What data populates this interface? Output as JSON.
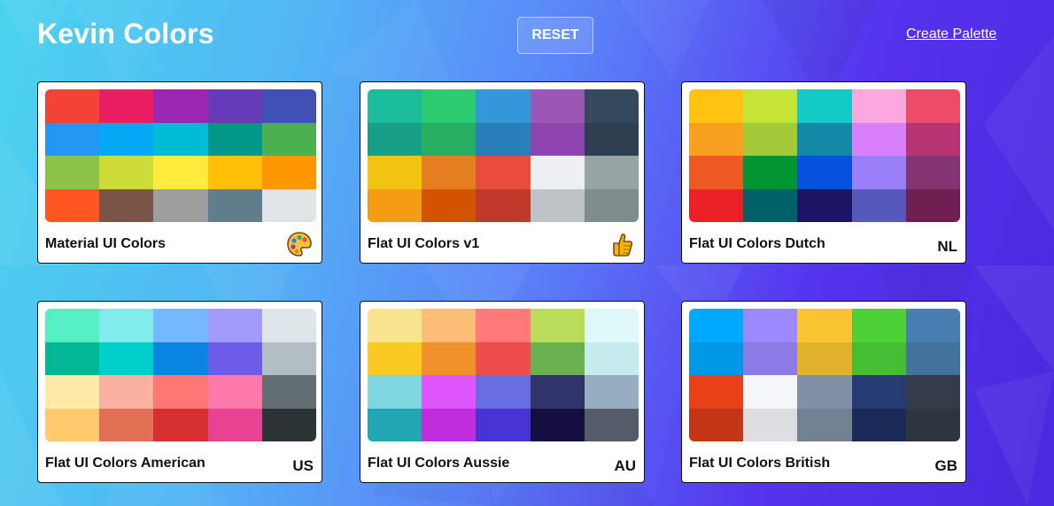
{
  "header": {
    "brand": "Kevin Colors",
    "reset_label": "RESET",
    "create_label": "Create Palette"
  },
  "palettes": [
    {
      "name": "Material UI Colors",
      "badge_type": "emoji",
      "badge_icon": "palette-icon",
      "colors": [
        [
          "#f44336",
          "#e91e63",
          "#9c27b0",
          "#673ab7",
          "#3f51b5"
        ],
        [
          "#2196f3",
          "#03a9f4",
          "#00bcd4",
          "#009688",
          "#4caf50"
        ],
        [
          "#8bc34a",
          "#cddc39",
          "#ffeb3b",
          "#ffc107",
          "#ff9800"
        ],
        [
          "#ff5722",
          "#795548",
          "#9e9e9e",
          "#607d8b",
          "#dfe4e7"
        ]
      ]
    },
    {
      "name": "Flat UI Colors v1",
      "badge_type": "emoji",
      "badge_icon": "thumbs-up-icon",
      "colors": [
        [
          "#1abc9c",
          "#2ecc71",
          "#3498db",
          "#9b59b6",
          "#34495e"
        ],
        [
          "#16a085",
          "#27ae60",
          "#2980b9",
          "#8e44ad",
          "#2c3e50"
        ],
        [
          "#f1c40f",
          "#e67e22",
          "#e74c3c",
          "#ecf0f1",
          "#95a5a6"
        ],
        [
          "#f39c12",
          "#d35400",
          "#c0392b",
          "#bdc3c7",
          "#7f8c8d"
        ]
      ]
    },
    {
      "name": "Flat UI Colors Dutch",
      "badge_type": "code",
      "badge": "NL",
      "colors": [
        [
          "#ffc312",
          "#c4e538",
          "#12cbc4",
          "#fda7df",
          "#ed4c67"
        ],
        [
          "#f79f1f",
          "#a3cb38",
          "#1289a7",
          "#d980fa",
          "#b53471"
        ],
        [
          "#ee5a24",
          "#009432",
          "#0652dd",
          "#9980fa",
          "#833471"
        ],
        [
          "#ea2027",
          "#006266",
          "#1b1464",
          "#5758bb",
          "#6f1e51"
        ]
      ]
    },
    {
      "name": "Flat UI Colors American",
      "badge_type": "code",
      "badge": "US",
      "colors": [
        [
          "#55efc4",
          "#81ecec",
          "#74b9ff",
          "#a29bfe",
          "#dfe6e9"
        ],
        [
          "#00b894",
          "#00cec9",
          "#0984e3",
          "#6c5ce7",
          "#b2bec3"
        ],
        [
          "#ffeaa7",
          "#fab1a0",
          "#ff7675",
          "#fd79a8",
          "#636e72"
        ],
        [
          "#fdcb6e",
          "#e17055",
          "#d63031",
          "#e84393",
          "#2d3436"
        ]
      ]
    },
    {
      "name": "Flat UI Colors Aussie",
      "badge_type": "code",
      "badge": "AU",
      "colors": [
        [
          "#f6e58d",
          "#ffbe76",
          "#ff7979",
          "#badc58",
          "#dff9fb"
        ],
        [
          "#f9ca24",
          "#f0932b",
          "#eb4d4b",
          "#6ab04c",
          "#c7ecee"
        ],
        [
          "#7ed6df",
          "#e056fd",
          "#686de0",
          "#30336b",
          "#95afc0"
        ],
        [
          "#22a6b3",
          "#be2edd",
          "#4834d4",
          "#130f40",
          "#535c68"
        ]
      ]
    },
    {
      "name": "Flat UI Colors British",
      "badge_type": "code",
      "badge": "GB",
      "colors": [
        [
          "#00a8ff",
          "#9c88ff",
          "#fbc531",
          "#4cd137",
          "#487eb0"
        ],
        [
          "#0097e6",
          "#8c7ae6",
          "#e1b12c",
          "#44bd32",
          "#40739e"
        ],
        [
          "#e84118",
          "#f5f6fa",
          "#7f8fa6",
          "#273c75",
          "#353b48"
        ],
        [
          "#c23616",
          "#dcdde1",
          "#718093",
          "#192a56",
          "#2f3640"
        ]
      ]
    }
  ]
}
